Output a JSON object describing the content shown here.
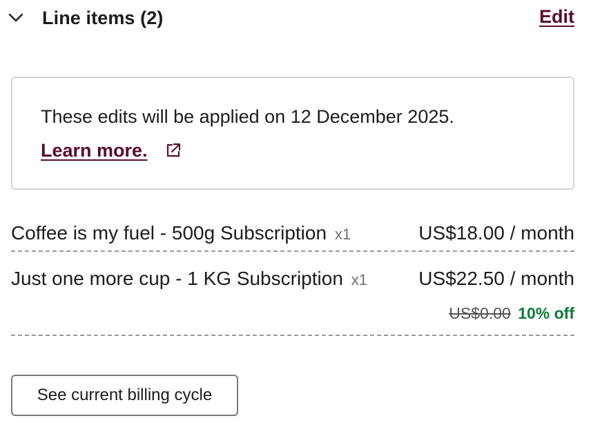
{
  "section": {
    "title": "Line items (2)",
    "edit_label": "Edit",
    "chevron_icon": "chevron-down-icon"
  },
  "notice": {
    "text": "These edits will be applied on 12 December 2025.",
    "link_label": "Learn more.",
    "link_icon": "external-link-icon"
  },
  "line_items": [
    {
      "name": "Coffee is my fuel - 500g Subscription",
      "quantity": "x1",
      "price": "US$18.00 / month"
    },
    {
      "name": "Just one more cup - 1 KG Subscription",
      "quantity": "x1",
      "price": "US$22.50 / month",
      "original_price": "US$0.00",
      "discount": "10% off"
    }
  ],
  "billing_button_label": "See current billing cycle",
  "colors": {
    "link": "#5b0b2c",
    "discount": "#0a7c33",
    "border": "#d4d4d4",
    "divider": "#9a9a9a"
  }
}
